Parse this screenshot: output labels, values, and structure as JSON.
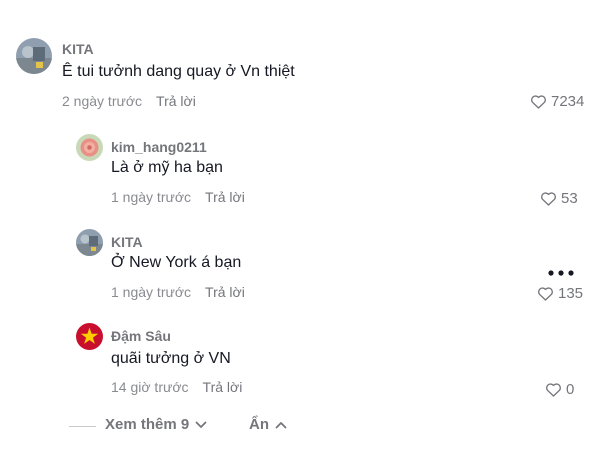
{
  "comments": [
    {
      "username": "KITA",
      "text": "Ê tui tưởnh dang quay ở Vn thiệt",
      "time": "2 ngày trước",
      "reply_label": "Trả lời",
      "likes": "7234"
    },
    {
      "username": "kim_hang0211",
      "text": "Là ở mỹ ha bạn",
      "time": "1 ngày trước",
      "reply_label": "Trả lời",
      "likes": "53"
    },
    {
      "username": "KITA",
      "text": "Ở New York á bạn",
      "time": "1 ngày trước",
      "reply_label": "Trả lời",
      "likes": "135"
    },
    {
      "username": "Đậm Sâu",
      "text": "quãi tưởng ở VN",
      "time": "14 giờ trước",
      "reply_label": "Trả lời",
      "likes": "0"
    }
  ],
  "footer": {
    "view_more_label": "Xem thêm 9",
    "hide_label": "Ẩn"
  },
  "icons": {
    "like": "heart-outline-icon",
    "more": "more-dots-icon",
    "expand": "chevron-down-icon",
    "collapse": "chevron-up-icon"
  },
  "colors": {
    "text_primary": "#161823",
    "text_secondary": "#75767c",
    "text_muted": "#8a8b91",
    "avatar_flag_red": "#c8102e",
    "avatar_flag_star": "#ffcd00"
  }
}
